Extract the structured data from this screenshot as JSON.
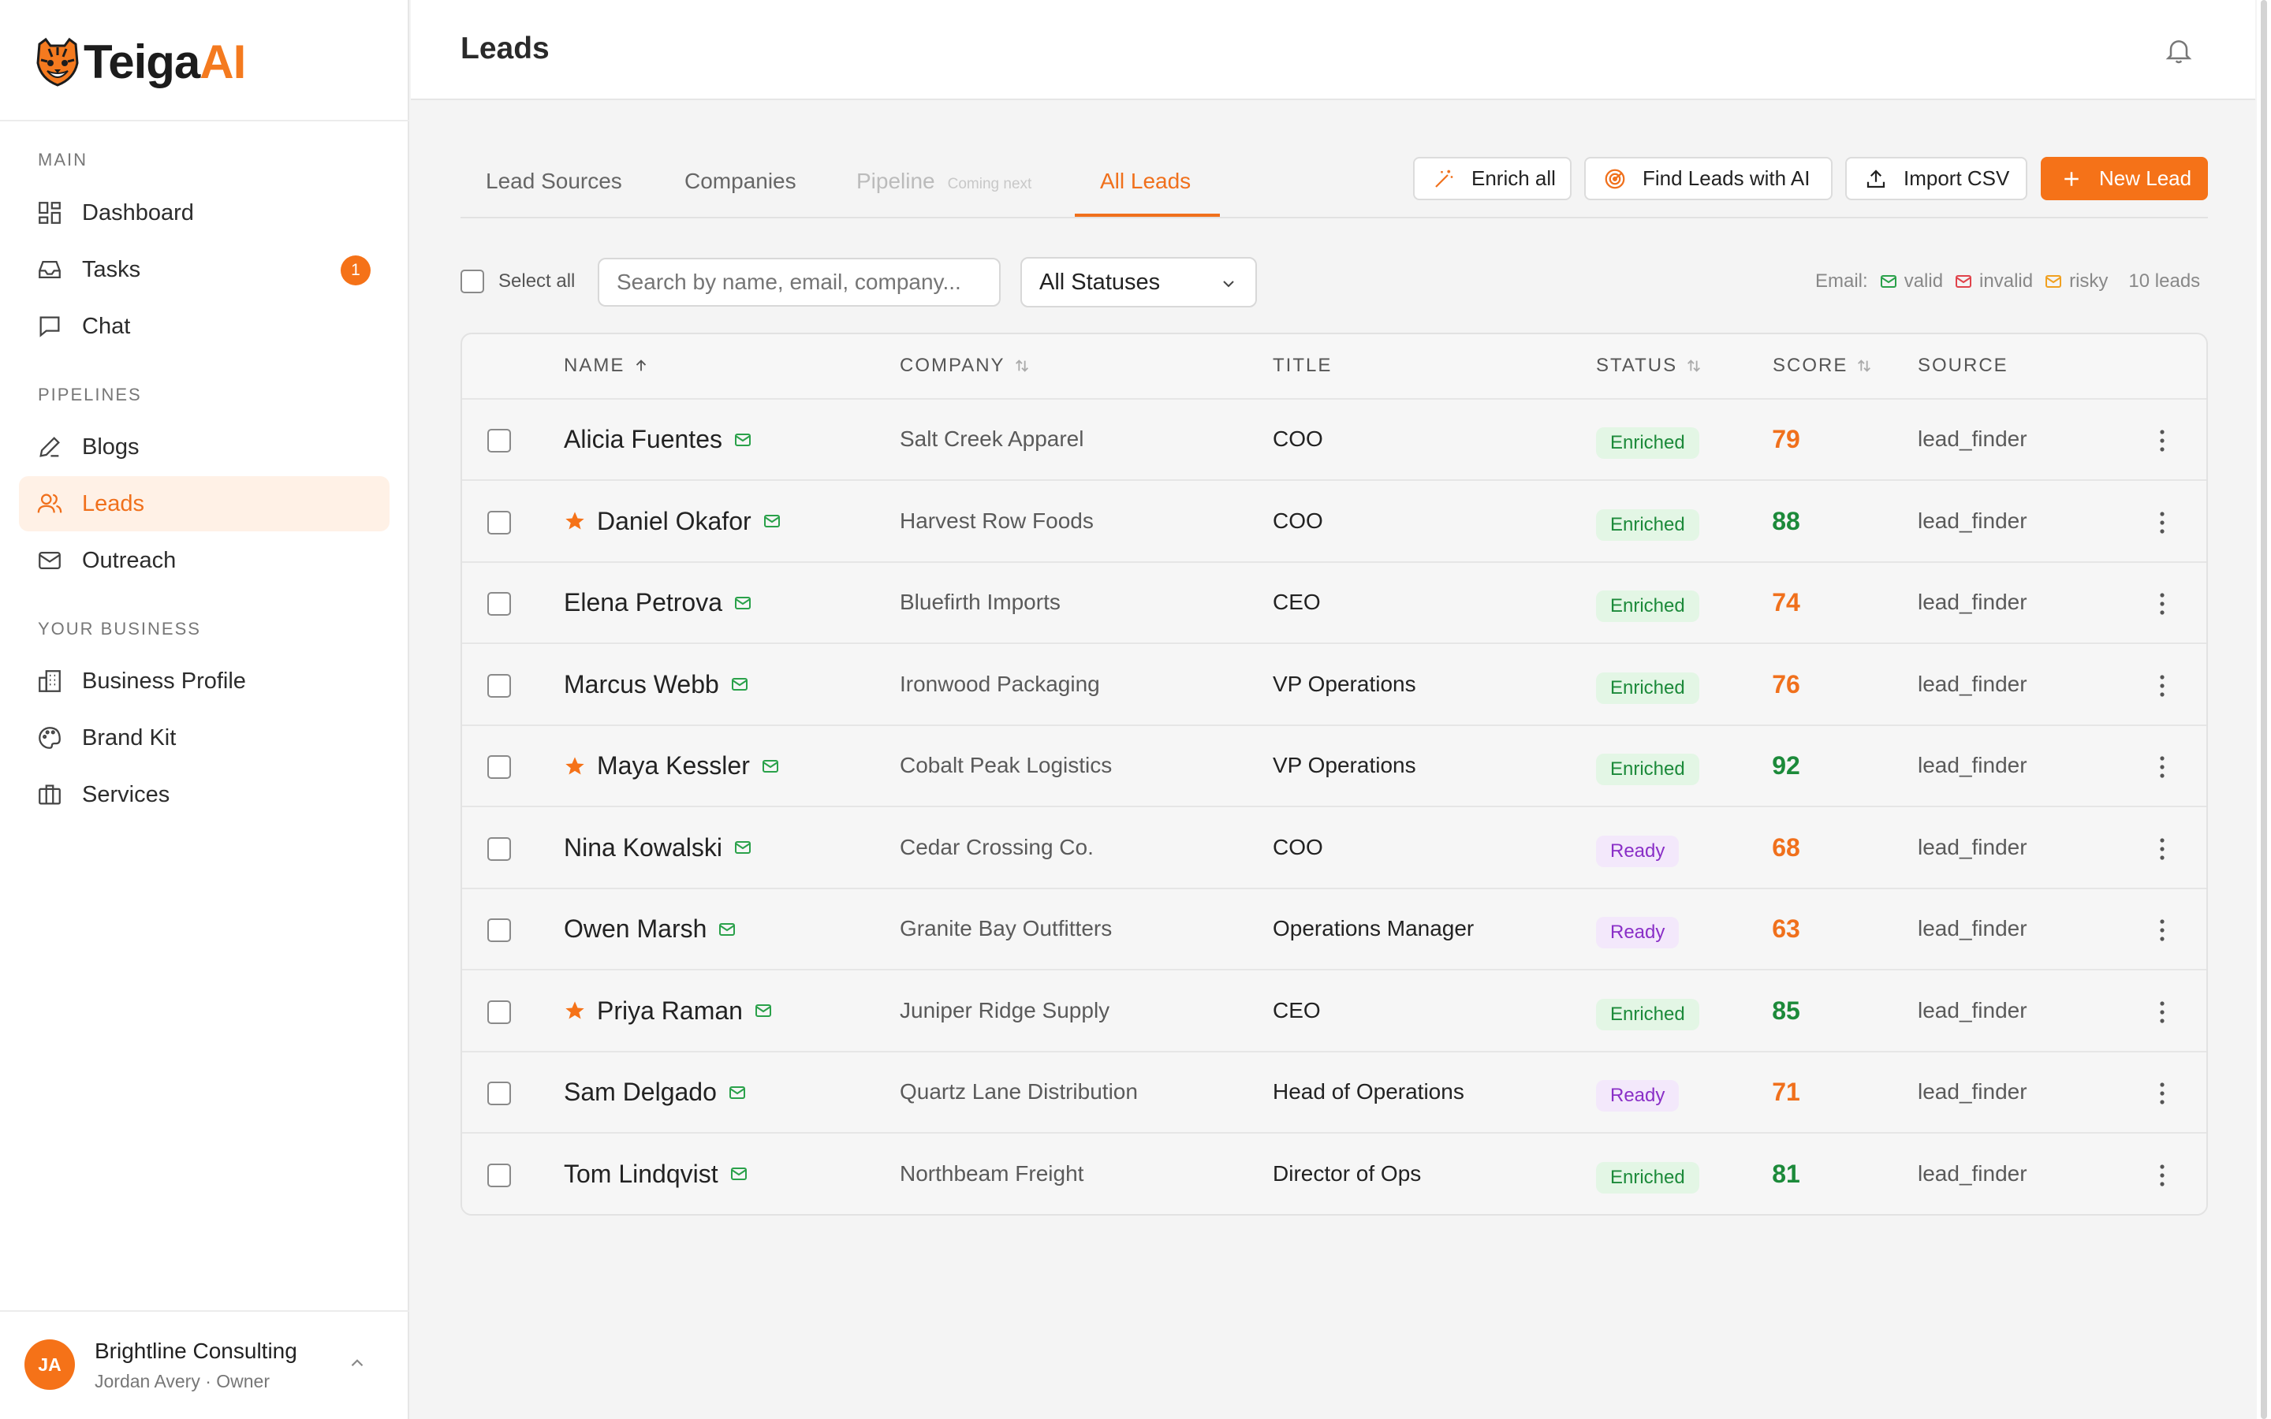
{
  "brand": {
    "name_part1": "Teiga",
    "name_part2": "AI"
  },
  "sidebar": {
    "sections": [
      "MAIN",
      "PIPELINES",
      "YOUR BUSINESS"
    ],
    "items": [
      {
        "label": "Dashboard",
        "icon": "dashboard-icon"
      },
      {
        "label": "Tasks",
        "icon": "inbox-icon",
        "badge": "1"
      },
      {
        "label": "Chat",
        "icon": "chat-icon"
      },
      {
        "label": "Blogs",
        "icon": "pen-icon"
      },
      {
        "label": "Leads",
        "icon": "users-icon",
        "active": true
      },
      {
        "label": "Outreach",
        "icon": "mail-icon"
      },
      {
        "label": "Business Profile",
        "icon": "building-icon"
      },
      {
        "label": "Brand Kit",
        "icon": "palette-icon"
      },
      {
        "label": "Services",
        "icon": "briefcase-icon"
      }
    ],
    "org": {
      "initials": "JA",
      "name": "Brightline Consulting",
      "user": "Jordan Avery · Owner"
    }
  },
  "header": {
    "title": "Leads"
  },
  "tabs": [
    {
      "label": "Lead Sources"
    },
    {
      "label": "Companies"
    },
    {
      "label": "Pipeline",
      "note": "Coming next",
      "disabled": true
    },
    {
      "label": "All Leads",
      "active": true
    }
  ],
  "actions": {
    "enrich": "Enrich all",
    "find": "Find Leads with AI",
    "import": "Import CSV",
    "new": "New Lead"
  },
  "filters": {
    "select_all": "Select all",
    "search_placeholder": "Search by name, email, company...",
    "status": "All Statuses"
  },
  "email_legend": {
    "label": "Email:",
    "valid": "valid",
    "invalid": "invalid",
    "risky": "risky",
    "count": "10 leads"
  },
  "columns": {
    "name": "NAME",
    "company": "COMPANY",
    "title": "TITLE",
    "status": "STATUS",
    "score": "SCORE",
    "source": "SOURCE"
  },
  "colors": {
    "accent": "#f57218",
    "score_high": "#1c8a3a",
    "score_mid": "#f0701c",
    "valid": "#2aa14a",
    "invalid": "#e0434b",
    "risky": "#f0a020"
  },
  "leads": [
    {
      "name": "Alicia Fuentes",
      "starred": false,
      "company": "Salt Creek Apparel",
      "title": "COO",
      "status": "Enriched",
      "score": "79",
      "source": "lead_finder"
    },
    {
      "name": "Daniel Okafor",
      "starred": true,
      "company": "Harvest Row Foods",
      "title": "COO",
      "status": "Enriched",
      "score": "88",
      "source": "lead_finder"
    },
    {
      "name": "Elena Petrova",
      "starred": false,
      "company": "Bluefirth Imports",
      "title": "CEO",
      "status": "Enriched",
      "score": "74",
      "source": "lead_finder"
    },
    {
      "name": "Marcus Webb",
      "starred": false,
      "company": "Ironwood Packaging",
      "title": "VP Operations",
      "status": "Enriched",
      "score": "76",
      "source": "lead_finder"
    },
    {
      "name": "Maya Kessler",
      "starred": true,
      "company": "Cobalt Peak Logistics",
      "title": "VP Operations",
      "status": "Enriched",
      "score": "92",
      "source": "lead_finder"
    },
    {
      "name": "Nina Kowalski",
      "starred": false,
      "company": "Cedar Crossing Co.",
      "title": "COO",
      "status": "Ready",
      "score": "68",
      "source": "lead_finder"
    },
    {
      "name": "Owen Marsh",
      "starred": false,
      "company": "Granite Bay Outfitters",
      "title": "Operations Manager",
      "status": "Ready",
      "score": "63",
      "source": "lead_finder"
    },
    {
      "name": "Priya Raman",
      "starred": true,
      "company": "Juniper Ridge Supply",
      "title": "CEO",
      "status": "Enriched",
      "score": "85",
      "source": "lead_finder"
    },
    {
      "name": "Sam Delgado",
      "starred": false,
      "company": "Quartz Lane Distribution",
      "title": "Head of Operations",
      "status": "Ready",
      "score": "71",
      "source": "lead_finder"
    },
    {
      "name": "Tom Lindqvist",
      "starred": false,
      "company": "Northbeam Freight",
      "title": "Director of Ops",
      "status": "Enriched",
      "score": "81",
      "source": "lead_finder"
    }
  ]
}
